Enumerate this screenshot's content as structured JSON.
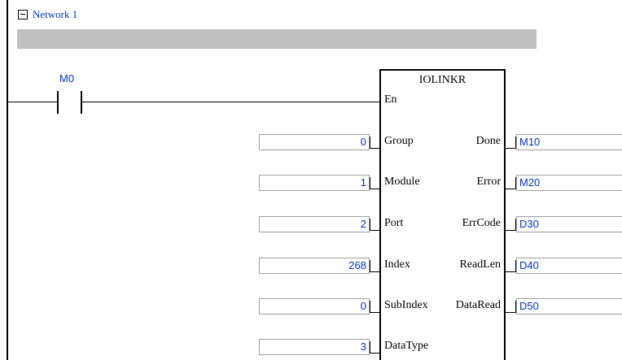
{
  "network": {
    "label": "Network 1"
  },
  "contact": {
    "label": "M0"
  },
  "function_block": {
    "name": "IOLINKR",
    "enable_pin": "En",
    "inputs": [
      {
        "pin": "Group",
        "value": "0"
      },
      {
        "pin": "Module",
        "value": "1"
      },
      {
        "pin": "Port",
        "value": "2"
      },
      {
        "pin": "Index",
        "value": "268"
      },
      {
        "pin": "SubIndex",
        "value": "0"
      },
      {
        "pin": "DataType",
        "value": "3"
      }
    ],
    "outputs": [
      {
        "pin": "Done",
        "value": "M10"
      },
      {
        "pin": "Error",
        "value": "M20"
      },
      {
        "pin": "ErrCode",
        "value": "D30"
      },
      {
        "pin": "ReadLen",
        "value": "D40"
      },
      {
        "pin": "DataRead",
        "value": "D50"
      }
    ]
  }
}
